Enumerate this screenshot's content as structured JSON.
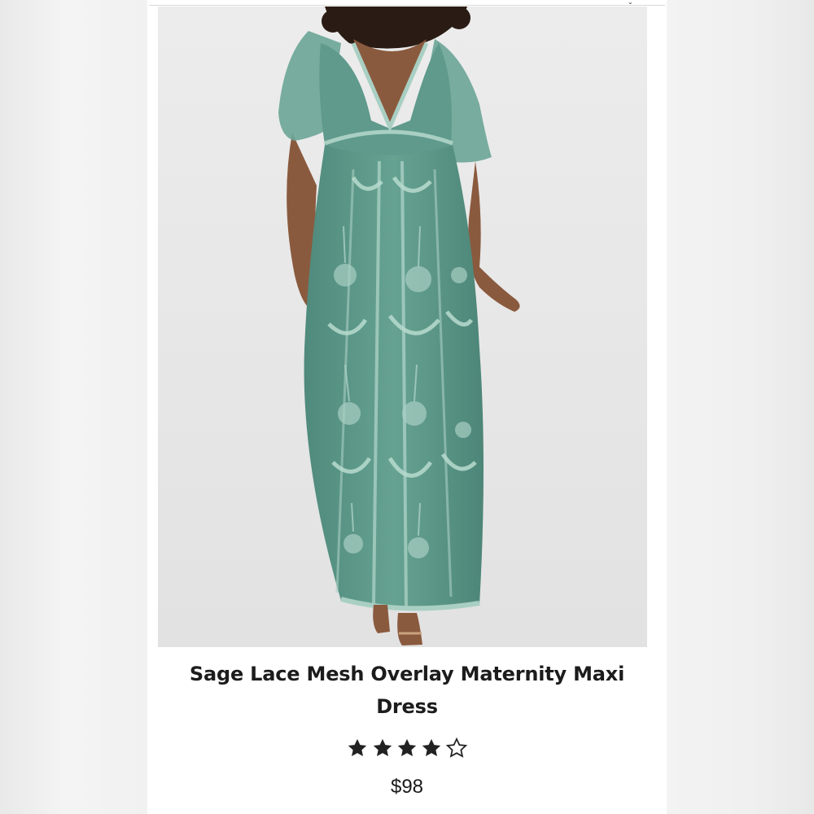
{
  "product": {
    "image_alt": "Sage lace mesh overlay maternity maxi dress worn by model",
    "title_line1": "Sage Lace Mesh Overlay Maternity Maxi",
    "title_line2": "Dress",
    "rating": {
      "value": 4,
      "max": 5
    },
    "price": "$98"
  },
  "colors": {
    "dress": "#5f9a8c",
    "dress_dark": "#4a8275",
    "lace": "#a9cfc3",
    "skin": "#8a5a3e",
    "hair": "#2a1c14",
    "star": "#222222",
    "background": "#e8e8e8"
  },
  "icons": {
    "star_filled": "star-filled-icon",
    "star_empty": "star-outline-icon"
  }
}
